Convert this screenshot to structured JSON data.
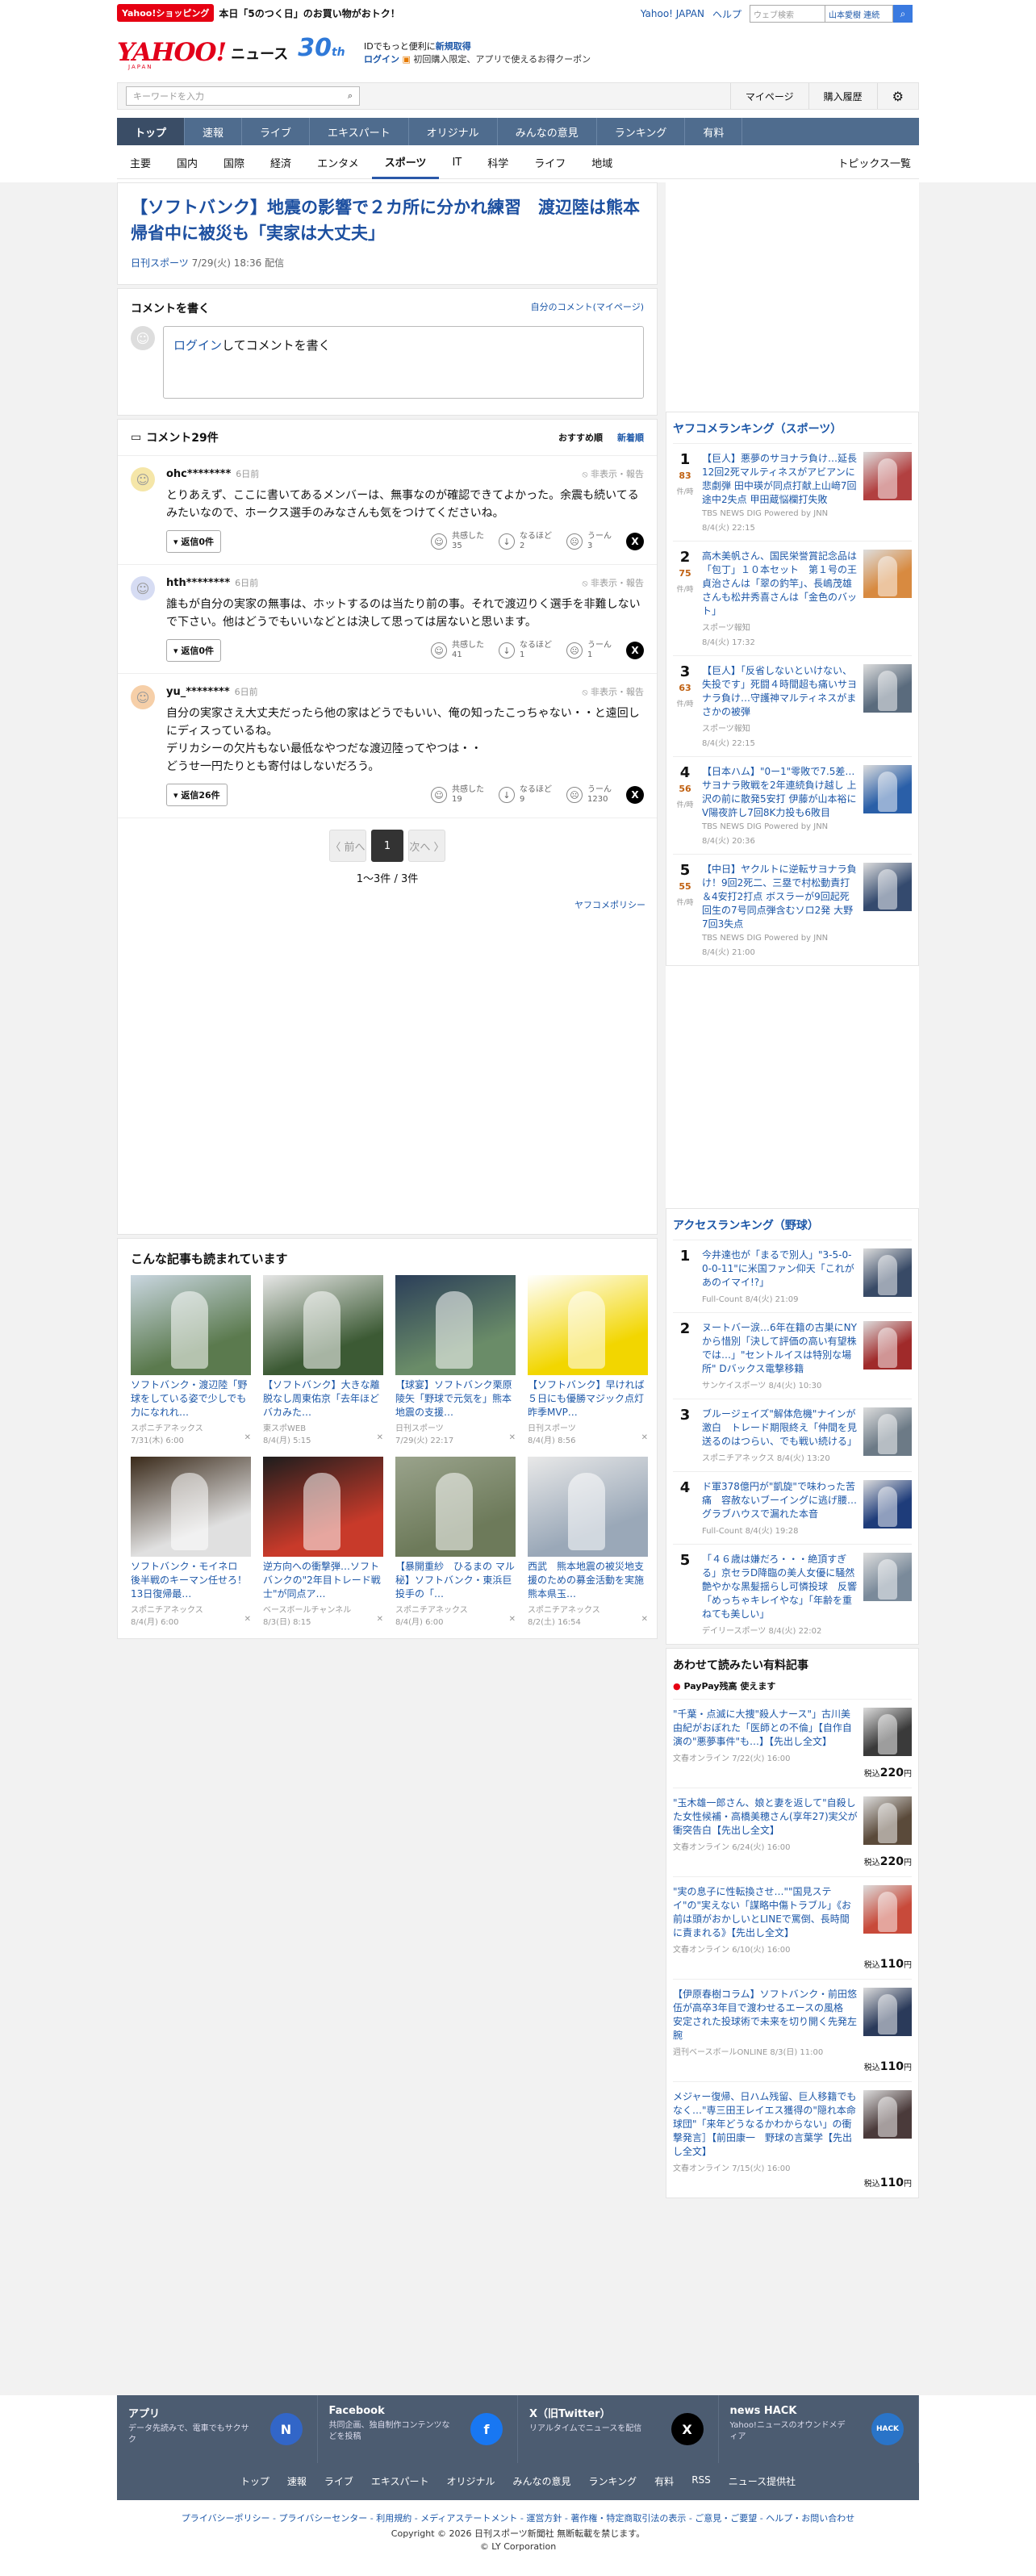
{
  "header": {
    "promo_tag": "Yahoo!ショッピング",
    "promo_text": "本日「5のつく日」のお買い物がおトク！",
    "yahoo_japan": "Yahoo! JAPAN",
    "help": "ヘルプ",
    "web_search_placeholder": "ウェブ検索",
    "trend_search": "山本愛樹 連続",
    "logo_yahoo": "YAHOO!",
    "logo_japan": "JAPAN",
    "logo_news": "ニュース",
    "logo_30": "30",
    "logo_th": "th",
    "msg_line1_pre": "IDでもっと便利に",
    "msg_line1_link": "新規取得",
    "msg_login": "ログイン",
    "msg_coupon": "初回購入限定、アプリで使えるお得クーポン",
    "keyword_placeholder": "キーワードを入力",
    "mypage": "マイページ",
    "purchase_history": "購入履歴"
  },
  "nav_main": [
    "トップ",
    "速報",
    "ライブ",
    "エキスパート",
    "オリジナル",
    "みんなの意見",
    "ランキング",
    "有料"
  ],
  "nav_sub": [
    "主要",
    "国内",
    "国際",
    "経済",
    "エンタメ",
    "スポーツ",
    "IT",
    "科学",
    "ライフ",
    "地域"
  ],
  "nav_sub_last": "トピックス一覧",
  "article": {
    "title": "【ソフトバンク】地震の影響で２カ所に分かれ練習　渡辺陸は熊本帰省中に被災も「実家は大丈夫」",
    "source": "日刊スポーツ",
    "date": "7/29(火) 18:36 配信"
  },
  "comment_write": {
    "title": "コメントを書く",
    "my_comments": "自分のコメント(マイページ)",
    "login": "ログイン",
    "prompt": "してコメントを書く"
  },
  "comments": {
    "count_label": "コメント29件",
    "sort_recommended": "おすすめ順",
    "sort_new": "新着順",
    "items": [
      {
        "user": "ohc********",
        "ago": "6日前",
        "report": "非表示・報告",
        "text": "とりあえず、ここに書いてあるメンバーは、無事なのが確認できてよかった。余震も続いてるみたいなので、ホークス選手のみなさんも気をつけてくださいね。",
        "replies": "返信0件",
        "r1_label": "共感した",
        "r1": "35",
        "r2_label": "なるほど",
        "r2": "2",
        "r3_label": "うーん",
        "r3": "3",
        "avatar": "☺",
        "avbg": "#f5e6a8"
      },
      {
        "user": "hth********",
        "ago": "6日前",
        "report": "非表示・報告",
        "text": "誰もが自分の実家の無事は、ホットするのは当たり前の事。それで渡辺りく選手を非難しないで下さい。他はどうでもいいなどとは決して思っては居ないと思います。",
        "replies": "返信0件",
        "r1_label": "共感した",
        "r1": "41",
        "r2_label": "なるほど",
        "r2": "1",
        "r3_label": "うーん",
        "r3": "1",
        "avatar": "☺",
        "avbg": "#d6dcf3"
      },
      {
        "user": "yu_********",
        "ago": "6日前",
        "report": "非表示・報告",
        "text": "自分の実家さえ大丈夫だったら他の家はどうでもいい、俺の知ったこっちゃない・・と遠回しにディスっているね。\nデリカシーの欠片もない最低なやつだな渡辺陸ってやつは・・\nどうせ一円たりとも寄付はしないだろう。",
        "replies": "返信26件",
        "r1_label": "共感した",
        "r1": "19",
        "r2_label": "なるほど",
        "r2": "9",
        "r3_label": "うーん",
        "r3": "1230",
        "avatar": "☺",
        "avbg": "#f6cfa8"
      }
    ]
  },
  "pager": {
    "prev": "〈 前へ",
    "current": "1",
    "next": "次へ 〉",
    "count": "1〜3件 / 3件"
  },
  "policy": "ヤフコメポリシー",
  "related": {
    "title": "こんな記事も読まれています",
    "items": [
      {
        "title": "ソフトバンク・渡辺陸「野球をしている姿で少しでも力になれれ…",
        "source": "スポニチアネックス",
        "date": "7/31(木) 6:00",
        "bg": "#5b7a4e",
        "bg2": "#c9d6e0"
      },
      {
        "title": "【ソフトバンク】大きな離脱なし周東佑京「去年ほどバカみた…",
        "source": "東スポWEB",
        "date": "8/4(月) 5:15",
        "bg": "#3c5a34",
        "bg2": "#e6e6e6"
      },
      {
        "title": "【球宴】ソフトバンク栗原陵矢「野球で元気を」熊本地震の支援…",
        "source": "日刊スポーツ",
        "date": "7/29(火) 22:17",
        "bg": "#6a8c68",
        "bg2": "#2b3e59"
      },
      {
        "title": "【ソフトバンク】早ければ５日にも優勝マジック点灯　昨季MVP…",
        "source": "日刊スポーツ",
        "date": "8/4(月) 8:56",
        "bg": "#f2d600",
        "bg2": "#ffffff"
      },
      {
        "title": "ソフトバンク・モイネロ　後半戦のキーマン任せろ！13日復帰最…",
        "source": "スポニチアネックス",
        "date": "8/4(月) 6:00",
        "bg": "#e0e0e0",
        "bg2": "#3a2a1a"
      },
      {
        "title": "逆方向への衝撃弾…ソフトバンクの\"2年目トレード戦士\"が同点ア…",
        "source": "ベースボールチャンネル",
        "date": "8/3(日) 8:15",
        "bg": "#c83a2a",
        "bg2": "#1d1d1d"
      },
      {
        "title": "【暴開重紗　ひるまの マル秘】ソフトバンク・東浜巨投手の「…",
        "source": "スポニチアネックス",
        "date": "8/4(月) 6:00",
        "bg": "#6d7a5a",
        "bg2": "#9aa38c"
      },
      {
        "title": "西武　熊本地震の被災地支援のための募金活動を実施　熊本県玉…",
        "source": "スポニチアネックス",
        "date": "8/2(土) 16:54",
        "bg": "#9aa8b8",
        "bg2": "#e8e8e8"
      }
    ]
  },
  "yafukome_ranking": {
    "title": "ヤフコメランキング（スポーツ）",
    "unit": "件/時",
    "items": [
      {
        "rank": "1",
        "count": "83",
        "title": "【巨人】悪夢のサヨナラ負け…延長12回2死マルティネスがアビアンに悲劇弾 田中瑛が同点打献上山﨑7回途中2失点 甲田蔵悩欄打失敗",
        "meta": "TBS NEWS DIG Powered by JNN",
        "date": "8/4(火) 22:15",
        "bg": "#b24040"
      },
      {
        "rank": "2",
        "count": "75",
        "title": "高木美帆さん、国民栄誉賞記念品は「包丁」１０本セット　第１号の王貞治さんは「翠の釣竿」、長嶋茂雄さんも松井秀喜さんは「金色のバット」",
        "meta": "スポーツ報知",
        "date": "8/4(火) 17:32",
        "bg": "#d88a40"
      },
      {
        "rank": "3",
        "count": "63",
        "title": "【巨人】「反省しないといけない、失投です」死闘４時間超も痛いサヨナラ負け…守護神マルティネスがまさかの被弾",
        "meta": "スポーツ報知",
        "date": "8/4(火) 22:15",
        "bg": "#5a6b7d"
      },
      {
        "rank": "4",
        "count": "56",
        "title": "【日本ハム】\"0ー1\"零敗で7.5差…サヨナラ敗戦を2年連続負け越し 上沢の前に散発5安打 伊藤が山本裕に V陽夜許し7回8K力投も6敗目",
        "meta": "TBS NEWS DIG Powered by JNN",
        "date": "8/4(火) 20:36",
        "bg": "#2a5fa8"
      },
      {
        "rank": "5",
        "count": "55",
        "title": "【中日】ヤクルトに逆転サヨナラ負け！9回2死二、三塁で村松動責打＆4安打2打点 ボスラーが9回起死回生の7号同点弾含むソロ2発 大野7回3失点",
        "meta": "TBS NEWS DIG Powered by JNN",
        "date": "8/4(火) 21:00",
        "bg": "#344a6e"
      }
    ]
  },
  "access_ranking": {
    "title": "アクセスランキング（野球）",
    "items": [
      {
        "rank": "1",
        "title": "今井達也が「まるで別人」\"3-5-0-0-0-11\"に米国ファン仰天「これがあのイマイ!?」",
        "meta": "Full-Count",
        "date": "8/4(火) 21:09",
        "bg": "#384a66"
      },
      {
        "rank": "2",
        "title": "ヌートバー涙…6年在籍の古巣にNYから惜別「決して評価の高い有望株では…」\"セントルイスは特別な場所\" Dバックス電撃移籍",
        "meta": "サンケイスポーツ",
        "date": "8/4(火) 10:30",
        "bg": "#a02a2a"
      },
      {
        "rank": "3",
        "title": "ブルージェイズ\"解体危機\"ナインが激白　トレード期限終え「仲間を見送るのはつらい、でも戦い続ける」",
        "meta": "スポニチアネックス",
        "date": "8/4(火) 13:20",
        "bg": "#6c7a86"
      },
      {
        "rank": "4",
        "title": "ド軍378億円が\"凱旋\"で味わった苦痛　容赦ないブーイングに逃げ腰…グラブハウスで漏れた本音",
        "meta": "Full-Count",
        "date": "8/4(火) 19:28",
        "bg": "#1e3c7a"
      },
      {
        "rank": "5",
        "title": "「４６歳は嫌だろ・・・絶頂すぎる」京セラD降臨の美人女優に騒然　艶やかな黒髪揺らし可憐投球　反響「めっちゃキレイやな」「年齢を重ねても美しい」",
        "meta": "デイリースポーツ",
        "date": "8/4(火) 22:02",
        "bg": "#7a8a9a"
      }
    ]
  },
  "paid": {
    "title": "あわせて読みたい有料記事",
    "paypay": "PayPay残高 使えます",
    "price_prefix": "税込",
    "price_unit": "円",
    "items": [
      {
        "title": "\"千葉・点滅に大捜\"殺人ナース\"」古川美由紀がおぼれた「医師との不倫」【自作自演の\"悪夢事件\"も…】【先出し全文】",
        "meta": "文春オンライン",
        "date": "7/22(火) 16:00",
        "price": "220",
        "bg": "#3a3a3a"
      },
      {
        "title": "\"玉木雄一郎さん、娘と妻を返して\"自殺した女性候補・高橋美穂さん(享年27)実父が衝突告白【先出し全文】",
        "meta": "文春オンライン",
        "date": "6/24(火) 16:00",
        "price": "220",
        "bg": "#5a4a3a"
      },
      {
        "title": "\"実の息子に性転換させ…\"\"国見ステイ\"の\"実えない「謀略中傷トラブル」《お前は頭がおかしいとLINEで罵倒、長時間に責まれる》【先出し全文】",
        "meta": "文春オンライン",
        "date": "6/10(火) 16:00",
        "price": "110",
        "bg": "#c84a3a"
      },
      {
        "title": "【伊原春樹コラム】ソフトバンク・前田悠伍が高卒3年目で渡わせるエースの風格　安定された投球術で未来を切り開く先発左腕",
        "meta": "週刊ベースボールONLINE",
        "date": "8/3(日) 11:00",
        "price": "110",
        "bg": "#2a3a5a"
      },
      {
        "title": "メジャー復帰、日ハム残留、巨人移籍でもなく…\"専三田王レイエス獲得の\"隠れ本命球団\"「来年どうなるかわからない」の衝撃発言］【前田康一　野球の言葉学【先出し全文】",
        "meta": "文春オンライン",
        "date": "7/15(火) 16:00",
        "price": "110",
        "bg": "#4a3a3a"
      }
    ]
  },
  "footer": {
    "apps": [
      {
        "title": "アプリ",
        "desc": "データ先読みで、電車でもサクサク",
        "icon": "N",
        "color": "#3266c8"
      },
      {
        "title": "Facebook",
        "desc": "共同企画、独自制作コンテンツなどを投稿",
        "icon": "f",
        "color": "#1877f2"
      },
      {
        "title": "X（旧Twitter）",
        "desc": "リアルタイムでニュースを配信",
        "icon": "X",
        "color": "#000000"
      },
      {
        "title": "news HACK",
        "desc": "Yahoo!ニュースのオウンドメディア",
        "icon": "HACK",
        "color": "#2a74c8"
      }
    ],
    "links": [
      "トップ",
      "速報",
      "ライブ",
      "エキスパート",
      "オリジナル",
      "みんなの意見",
      "ランキング",
      "有料",
      "RSS",
      "ニュース提供社"
    ],
    "legal": "プライバシーポリシー - プライバシーセンター - 利用規約 - メディアステートメント - 運営方針 - 著作権・特定商取引法の表示 - ご意見・ご要望 - ヘルプ・お問い合わせ",
    "copyright": "Copyright © 2026 日刊スポーツ新聞社 無断転載を禁じます。",
    "ly": "© LY Corporation"
  }
}
